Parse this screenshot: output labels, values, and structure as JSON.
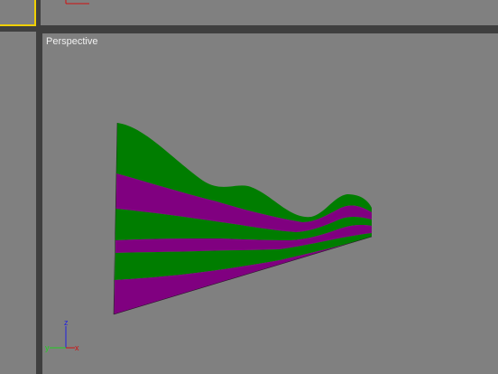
{
  "viewports": {
    "perspective": {
      "label": "Perspective"
    }
  },
  "axes": {
    "x_label": "x",
    "y_label": "y",
    "z_label": "z",
    "x_color": "#d01010",
    "y_color": "#20d020",
    "z_color": "#2020e0"
  },
  "object": {
    "stripe_colors": [
      "#007d00",
      "#800080"
    ]
  },
  "colors": {
    "viewport_bg": "#808080",
    "separator": "#3f3f3f",
    "active_border": "#f0d000"
  }
}
